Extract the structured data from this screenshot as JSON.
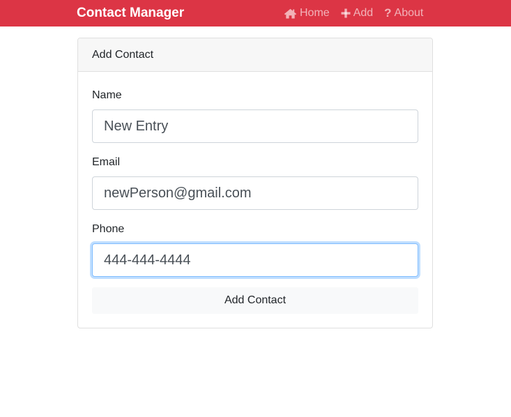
{
  "navbar": {
    "brand": "Contact Manager",
    "links": [
      {
        "label": "Home",
        "icon": "home-icon"
      },
      {
        "label": "Add",
        "icon": "plus-icon"
      },
      {
        "label": "About",
        "icon": "question-icon"
      }
    ],
    "bg_color": "#dc3545"
  },
  "card": {
    "header": "Add Contact",
    "fields": [
      {
        "label": "Name",
        "value": "New Entry"
      },
      {
        "label": "Email",
        "value": "newPerson@gmail.com"
      },
      {
        "label": "Phone",
        "value": "444-444-4444"
      }
    ],
    "submit_label": "Add Contact"
  }
}
